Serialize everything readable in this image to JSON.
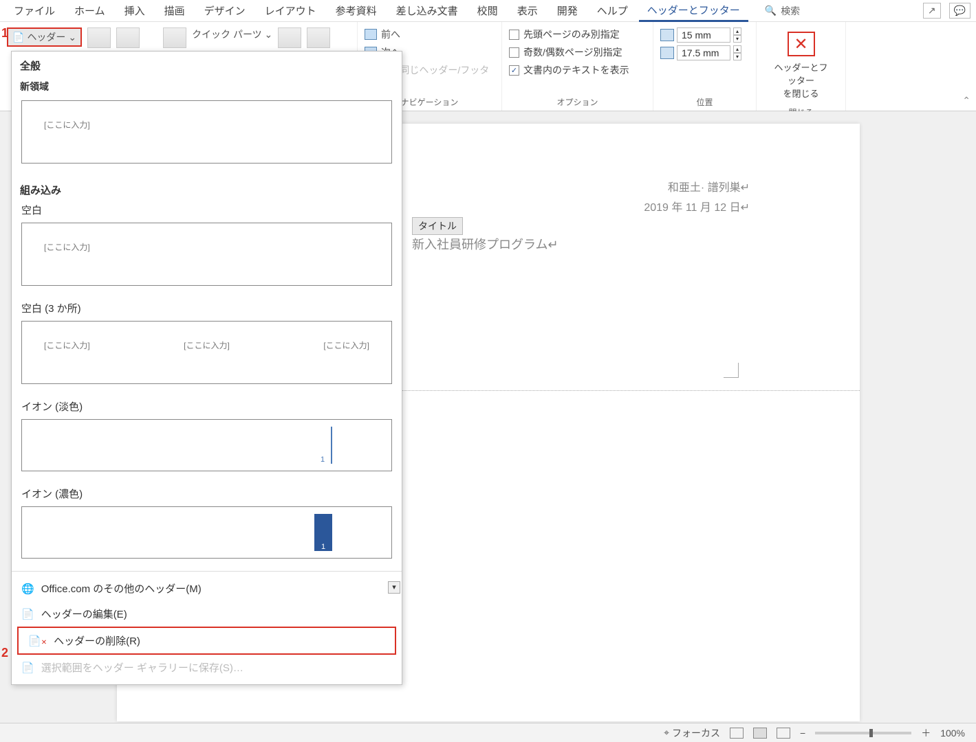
{
  "tabs": {
    "file": "ファイル",
    "home": "ホーム",
    "insert": "挿入",
    "draw": "描画",
    "design": "デザイン",
    "layout": "レイアウト",
    "references": "参考資料",
    "mailings": "差し込み文書",
    "review": "校閲",
    "view": "表示",
    "developer": "開発",
    "help": "ヘルプ",
    "header_footer": "ヘッダーとフッター",
    "search": "検索"
  },
  "ribbon": {
    "header_button": "ヘッダー ⌄",
    "quick_parts": "クイック パーツ ⌄",
    "nav": {
      "prev": "前へ",
      "next": "次へ",
      "same_as_prev": "前と同じヘッダー/フッター",
      "group": "ナビゲーション"
    },
    "options": {
      "first_page": "先頭ページのみ別指定",
      "odd_even": "奇数/偶数ページ別指定",
      "show_text": "文書内のテキストを表示",
      "group": "オプション"
    },
    "position": {
      "top": "15 mm",
      "bottom": "17.5 mm",
      "group": "位置"
    },
    "close": {
      "label": "ヘッダーとフッター\nを閉じる",
      "group": "閉じる"
    }
  },
  "dropdown": {
    "general": "全般",
    "new_region": "新領域",
    "placeholder": "[ここに入力]",
    "builtin": "組み込み",
    "blank": "空白",
    "blank3": "空白 (3 か所)",
    "ion_light": "イオン (淡色)",
    "ion_dark": "イオン (濃色)",
    "more_office": "Office.com のその他のヘッダー(M)",
    "edit_header": "ヘッダーの編集(E)",
    "remove_header": "ヘッダーの削除(R)",
    "save_selection": "選択範囲をヘッダー ギャラリーに保存(S)…"
  },
  "document": {
    "name_line": "和亜土· 譜列巣↵",
    "date_line": "2019 年 11 月 12 日↵",
    "title_tag": "タイトル",
    "title_text": "新入社員研修プログラム↵"
  },
  "status": {
    "focus": "フォーカス",
    "zoom": "100%"
  },
  "annotations": {
    "one": "1",
    "two": "2"
  }
}
